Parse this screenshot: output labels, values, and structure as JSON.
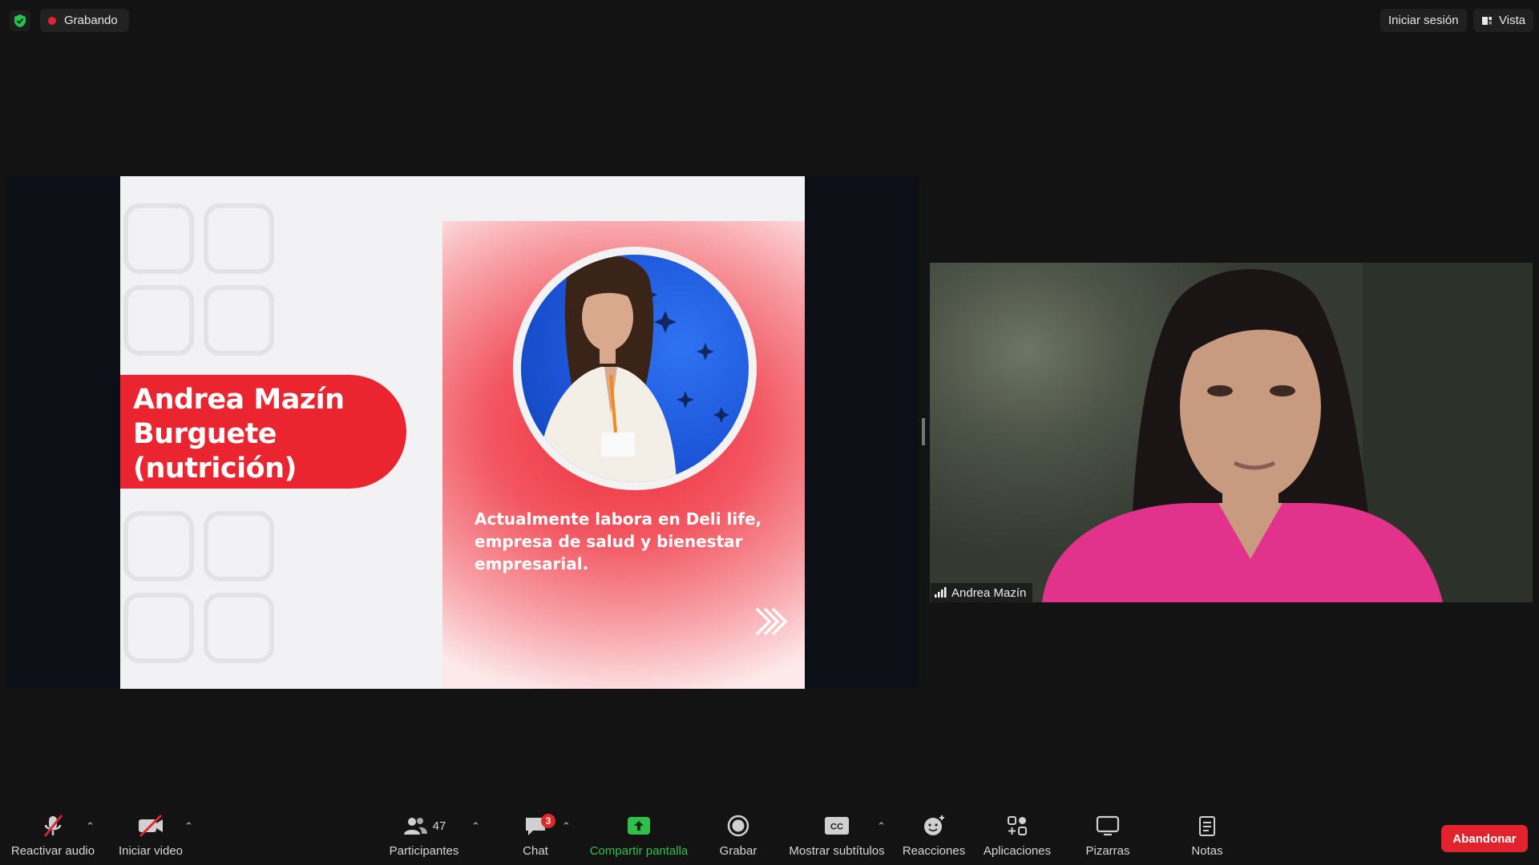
{
  "top_bar": {
    "recording_label": "Grabando",
    "signin_label": "Iniciar sesión",
    "view_label": "Vista"
  },
  "slide": {
    "name_lines": [
      "Andrea Mazín",
      "Burguete",
      "(nutrición)"
    ],
    "description": "Actualmente labora en Deli life, empresa de salud y bienestar empresarial."
  },
  "participant_video": {
    "name": "Andrea Mazín"
  },
  "toolbar": {
    "audio_label": "Reactivar audio",
    "video_label": "Iniciar video",
    "participants_label": "Participantes",
    "participants_count": "47",
    "chat_label": "Chat",
    "chat_badge": "3",
    "share_label": "Compartir pantalla",
    "record_label": "Grabar",
    "captions_label": "Mostrar subtítulos",
    "captions_icon_text": "CC",
    "reactions_label": "Reacciones",
    "apps_label": "Aplicaciones",
    "whiteboards_label": "Pizarras",
    "notes_label": "Notas",
    "leave_label": "Abandonar"
  },
  "colors": {
    "recording_red": "#e0232d",
    "share_green": "#30c04a",
    "slide_red": "#ea2530",
    "background": "#131313"
  },
  "icons": [
    "shield-check-icon",
    "recording-dot-icon",
    "view-icon",
    "signal-icon",
    "muted-mic-icon",
    "video-off-icon",
    "participants-icon",
    "chat-icon",
    "share-screen-icon",
    "record-icon",
    "captions-icon",
    "reactions-icon",
    "apps-icon",
    "whiteboard-icon",
    "notes-icon",
    "chevrons-right-icon"
  ]
}
